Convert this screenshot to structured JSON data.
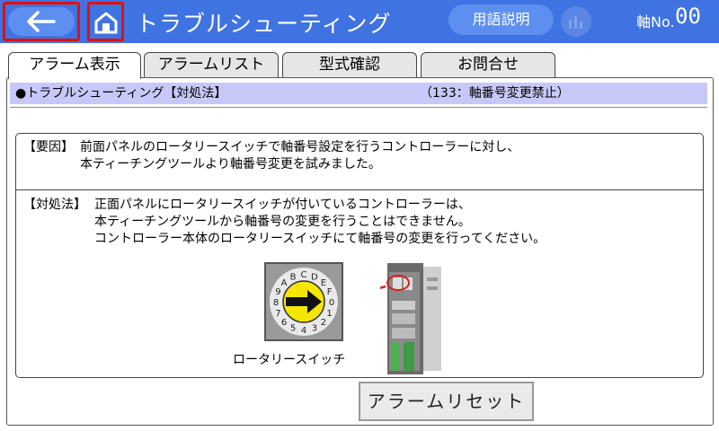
{
  "header": {
    "title": "トラブルシューティング",
    "term_button": "用語説明",
    "axis_label": "軸No.",
    "axis_value": "00",
    "icons": {
      "back": "arrow-left-icon",
      "home": "home-icon",
      "chart": "bar-chart-icon"
    }
  },
  "tabs": [
    {
      "label": "アラーム表示",
      "active": true
    },
    {
      "label": "アラームリスト",
      "active": false
    },
    {
      "label": "型式確認",
      "active": false
    },
    {
      "label": "お問合せ",
      "active": false
    }
  ],
  "section": {
    "title": "●トラブルシューティング【対処法】",
    "code": "（133：軸番号変更禁止）"
  },
  "cause": {
    "label": "【要因】",
    "line1": "前面パネルのロータリースイッチで軸番号設定を行うコントローラーに対し、",
    "line2": "本ティーチングツールより軸番号変更を試みました。"
  },
  "remedy": {
    "label": "【対処法】",
    "line1": "正面パネルにロータリースイッチが付いているコントローラーは、",
    "line2": "本ティーチングツールから軸番号の変更を行うことはできません。",
    "line3": "コントローラー本体のロータリースイッチにて軸番号の変更を行ってください。"
  },
  "diagram": {
    "switch_label": "ロータリースイッチ",
    "dial_chars": [
      "0",
      "1",
      "2",
      "3",
      "4",
      "5",
      "6",
      "7",
      "8",
      "9",
      "A",
      "B",
      "C",
      "D",
      "E",
      "F"
    ],
    "colors": {
      "dial": "#f5e600",
      "arrow": "#d42020",
      "header": "#3f73e1"
    }
  },
  "reset_button": "アラームリセット"
}
